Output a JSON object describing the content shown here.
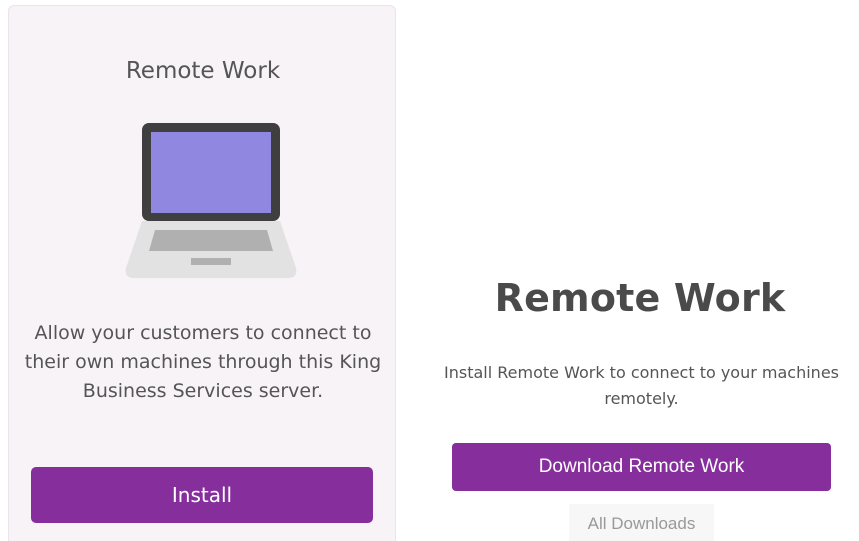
{
  "app_card": {
    "title": "Remote Work",
    "description": "Allow your customers to connect to their own machines through this King Business Services server.",
    "install_label": "Install",
    "icon": "laptop-icon"
  },
  "main": {
    "title": "Remote Work",
    "description": "Install Remote Work to connect to your machines remotely.",
    "download_label": "Download Remote Work",
    "all_downloads_label": "All Downloads"
  },
  "colors": {
    "accent": "#862e9c",
    "card_bg": "#f8f3f7",
    "screen": "#9088e0",
    "text": "#555555"
  }
}
